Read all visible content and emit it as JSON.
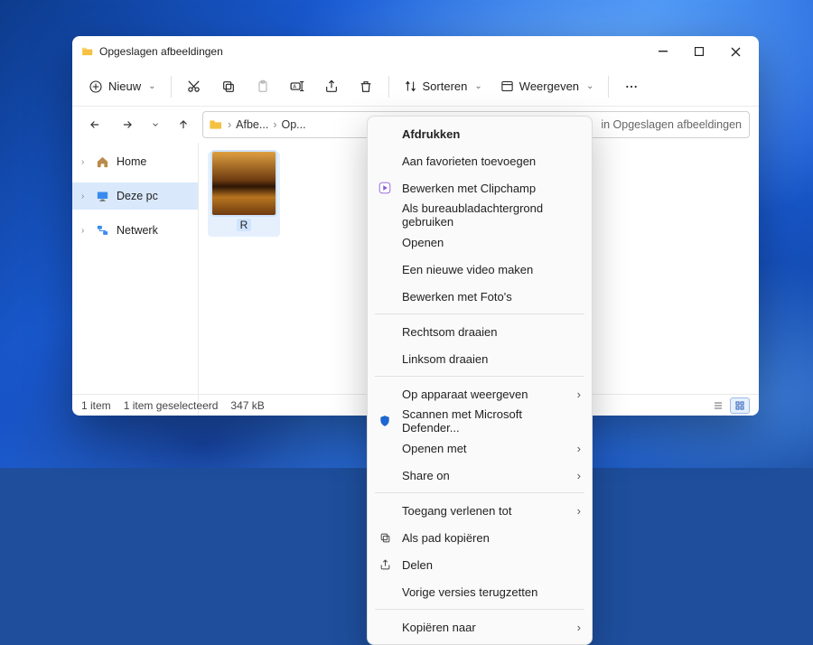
{
  "window": {
    "title": "Opgeslagen afbeeldingen"
  },
  "toolbar": {
    "new_label": "Nieuw",
    "sort_label": "Sorteren",
    "view_label": "Weergeven"
  },
  "breadcrumb": {
    "c1": "Afbe...",
    "c2": "Op...",
    "search_hint": "in Opgeslagen afbeeldingen"
  },
  "sidebar": {
    "home": "Home",
    "this_pc": "Deze pc",
    "network": "Netwerk"
  },
  "thumb": {
    "label": "R"
  },
  "status": {
    "count": "1 item",
    "selected": "1 item geselecteerd",
    "size": "347 kB"
  },
  "context": {
    "print": "Afdrukken",
    "add_fav": "Aan favorieten toevoegen",
    "clipchamp": "Bewerken met Clipchamp",
    "wallpaper": "Als bureaubladachtergrond gebruiken",
    "open": "Openen",
    "new_video": "Een nieuwe video maken",
    "photos": "Bewerken met Foto's",
    "rot_cw": "Rechtsom draaien",
    "rot_ccw": "Linksom draaien",
    "cast": "Op apparaat weergeven",
    "defender": "Scannen met Microsoft Defender...",
    "open_with": "Openen met",
    "share_on": "Share on",
    "give_access": "Toegang verlenen tot",
    "copy_path": "Als pad kopiëren",
    "share": "Delen",
    "prev_versions": "Vorige versies terugzetten",
    "copy_to": "Kopiëren naar"
  }
}
